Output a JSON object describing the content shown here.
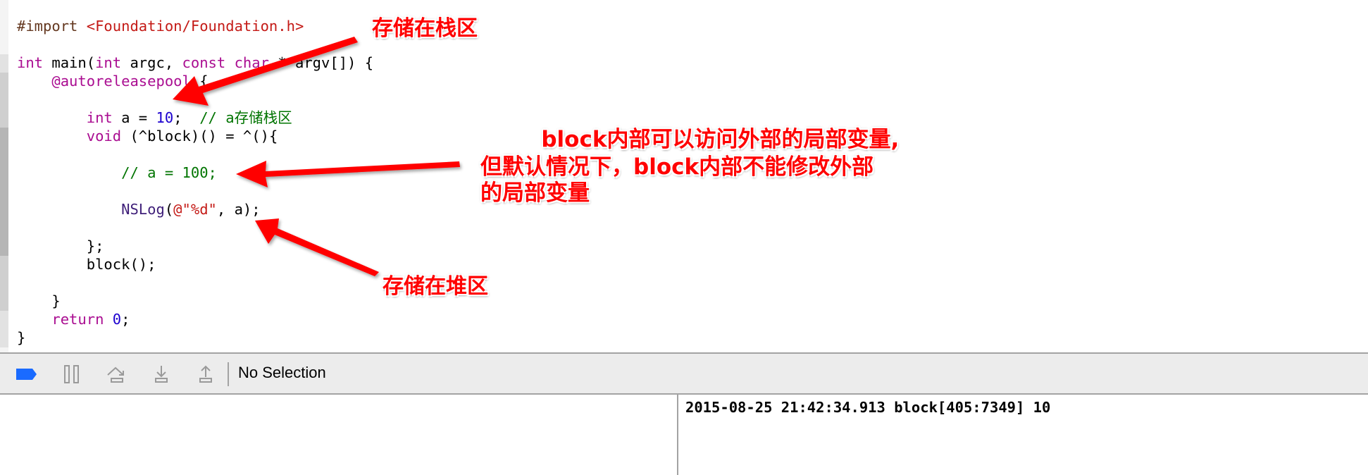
{
  "editor": {
    "lines": [
      [
        {
          "t": "#import ",
          "c": "pp"
        },
        {
          "t": "<Foundation/Foundation.h>",
          "c": "str"
        }
      ],
      [],
      [
        {
          "t": "int",
          "c": "kw"
        },
        {
          "t": " main(",
          "c": ""
        },
        {
          "t": "int",
          "c": "kw"
        },
        {
          "t": " argc, ",
          "c": ""
        },
        {
          "t": "const",
          "c": "kw"
        },
        {
          "t": " ",
          "c": ""
        },
        {
          "t": "char",
          "c": "kw"
        },
        {
          "t": " * argv[]) {",
          "c": ""
        }
      ],
      [
        {
          "t": "    ",
          "c": ""
        },
        {
          "t": "@autoreleasepool",
          "c": "kw"
        },
        {
          "t": " {",
          "c": ""
        }
      ],
      [],
      [
        {
          "t": "        ",
          "c": ""
        },
        {
          "t": "int",
          "c": "kw"
        },
        {
          "t": " a = ",
          "c": ""
        },
        {
          "t": "10",
          "c": "num"
        },
        {
          "t": ";  ",
          "c": ""
        },
        {
          "t": "// a存储栈区",
          "c": "cm"
        }
      ],
      [
        {
          "t": "        ",
          "c": ""
        },
        {
          "t": "void",
          "c": "kw"
        },
        {
          "t": " (^block)() = ^(){",
          "c": ""
        }
      ],
      [],
      [
        {
          "t": "            ",
          "c": ""
        },
        {
          "t": "// a = 100;",
          "c": "cm"
        }
      ],
      [],
      [
        {
          "t": "            ",
          "c": ""
        },
        {
          "t": "NSLog",
          "c": "cls"
        },
        {
          "t": "(",
          "c": ""
        },
        {
          "t": "@\"%d\"",
          "c": "str"
        },
        {
          "t": ", a);",
          "c": ""
        }
      ],
      [],
      [
        {
          "t": "        };",
          "c": ""
        }
      ],
      [
        {
          "t": "        block();",
          "c": ""
        }
      ],
      [],
      [
        {
          "t": "    }",
          "c": ""
        }
      ],
      [
        {
          "t": "    ",
          "c": ""
        },
        {
          "t": "return",
          "c": "kw"
        },
        {
          "t": " ",
          "c": ""
        },
        {
          "t": "0",
          "c": "num"
        },
        {
          "t": ";",
          "c": ""
        }
      ],
      [
        {
          "t": "}",
          "c": ""
        }
      ]
    ]
  },
  "annotations": {
    "stack_label": "存储在栈区",
    "heap_label": "存储在堆区",
    "note_line1": "        block内部可以访问外部的局部变量,",
    "note_line2": "但默认情况下，block内部不能修改外部",
    "note_line3": "的局部变量"
  },
  "debug_bar": {
    "breakpoints_icon": "breakpoint-toggle-icon",
    "pause_icon": "pause-icon",
    "step_over_icon": "step-over-icon",
    "step_into_icon": "step-into-icon",
    "step_out_icon": "step-out-icon",
    "selection_label": "No Selection",
    "accent_color": "#1a6bff"
  },
  "console": {
    "lines": [
      "2015-08-25 21:42:34.913 block[405:7349] 10"
    ]
  }
}
